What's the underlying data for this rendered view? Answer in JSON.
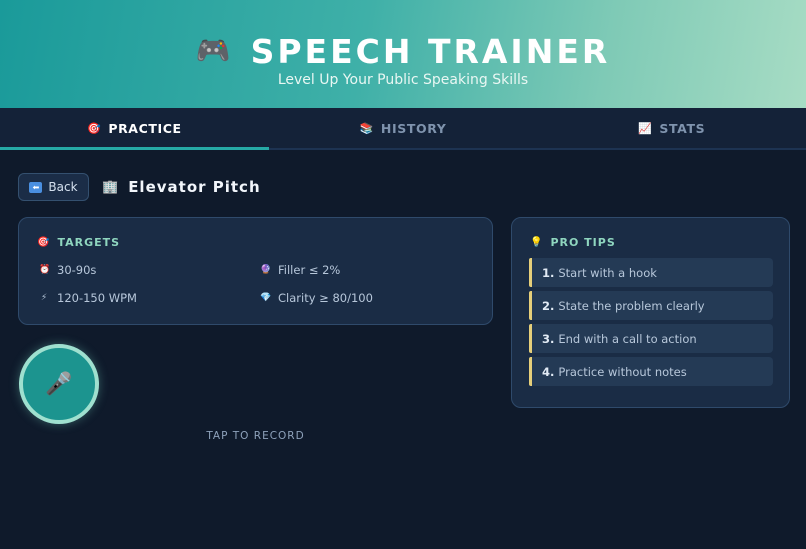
{
  "header": {
    "icon": "🎮",
    "title": "SPEECH TRAINER",
    "subtitle": "Level Up Your Public Speaking Skills"
  },
  "tabs": [
    {
      "icon": "🎯",
      "label": "PRACTICE",
      "active": true
    },
    {
      "icon": "📚",
      "label": "HISTORY",
      "active": false
    },
    {
      "icon": "📈",
      "label": "STATS",
      "active": false
    }
  ],
  "nav": {
    "back_label": "Back",
    "scenario_icon": "🏢",
    "scenario_title": "Elevator Pitch"
  },
  "targets": {
    "icon": "🎯",
    "title": "TARGETS",
    "items": [
      {
        "icon": "⏰",
        "label": "30-90s"
      },
      {
        "icon": "🔮",
        "label": "Filler ≤ 2%"
      },
      {
        "icon": "⚡",
        "label": "120-150 WPM"
      },
      {
        "icon": "💎",
        "label": "Clarity ≥ 80/100"
      }
    ]
  },
  "tips": {
    "icon": "💡",
    "title": "PRO TIPS",
    "items": [
      {
        "num": "1.",
        "text": "Start with a hook"
      },
      {
        "num": "2.",
        "text": "State the problem clearly"
      },
      {
        "num": "3.",
        "text": "End with a call to action"
      },
      {
        "num": "4.",
        "text": "Practice without notes"
      }
    ]
  },
  "record": {
    "icon": "🎤",
    "label": "TAP TO RECORD"
  },
  "colors": {
    "background": "#0f1a2b",
    "accent": "#26a9a5",
    "tip_border": "#e6cf7a",
    "card_title": "#8fd6bf"
  }
}
